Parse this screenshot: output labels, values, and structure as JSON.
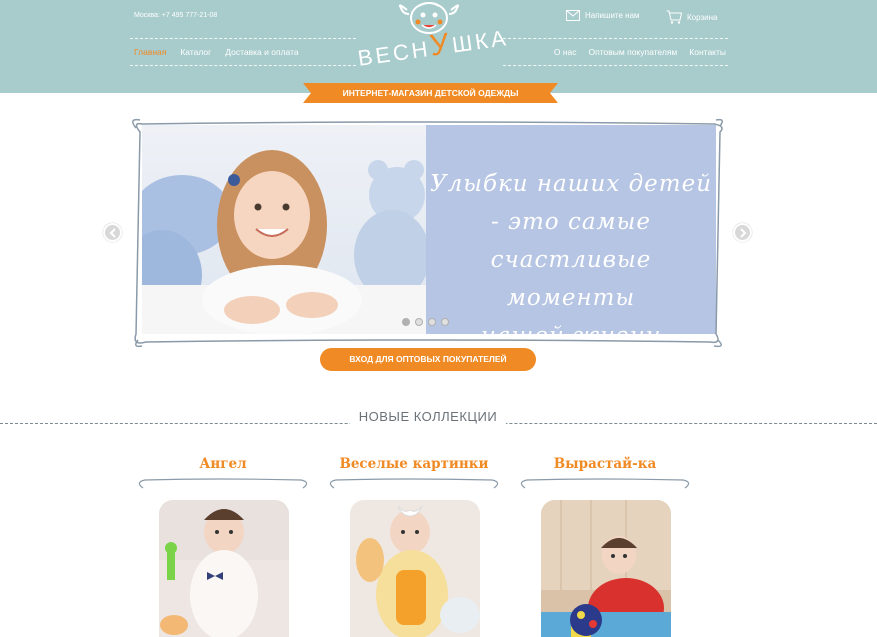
{
  "header": {
    "phone": "Москва: +7 495 777-21-08",
    "contact_link": "Напишите нам",
    "cart_link": "Корзина",
    "logo_text_before": "ВЕСН",
    "logo_text_accent": "У",
    "logo_text_after": "ШКА",
    "tagline": "ИНТЕРНЕТ-МАГАЗИН ДЕТСКОЙ ОДЕЖДЫ",
    "nav_left": [
      {
        "label": "Главная",
        "active": true
      },
      {
        "label": "Каталог",
        "active": false
      },
      {
        "label": "Доставка и оплата",
        "active": false
      }
    ],
    "nav_right": [
      {
        "label": "О нас"
      },
      {
        "label": "Оптовым покупателям"
      },
      {
        "label": "Контакты"
      }
    ]
  },
  "slider": {
    "quote_lines": [
      "Улыбки наших детей",
      "- это самые",
      "счастливые моменты",
      "нашей жизни"
    ],
    "dots_count": 4,
    "active_dot": 1
  },
  "wholesale_button": "ВХОД ДЛЯ ОПТОВЫХ ПОКУПАТЕЛЕЙ",
  "collections": {
    "title": "НОВЫЕ КОЛЛЕКЦИИ",
    "items": [
      {
        "name": "Ангел"
      },
      {
        "name": "Веселые картинки"
      },
      {
        "name": "Вырастай-ка"
      }
    ]
  },
  "colors": {
    "header_bg": "#a8cbcc",
    "accent": "#f08a24",
    "quote_bg": "#b6c5e3"
  }
}
